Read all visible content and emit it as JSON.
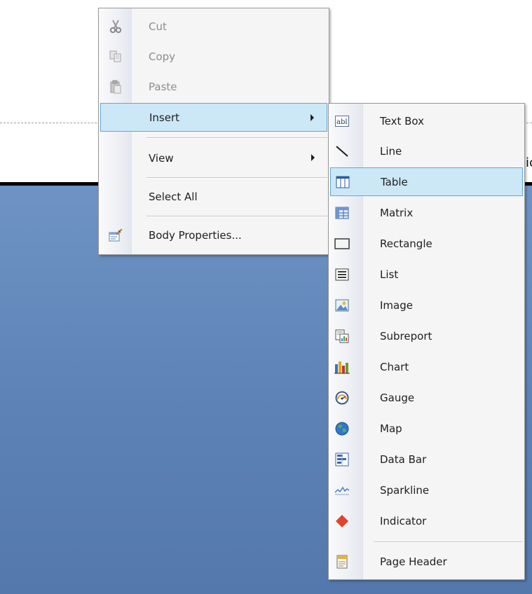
{
  "background": {
    "edge_text": "ic"
  },
  "context_menu": {
    "items": [
      {
        "label": "Cut",
        "icon": "scissors-icon",
        "enabled": false
      },
      {
        "label": "Copy",
        "icon": "copy-icon",
        "enabled": false
      },
      {
        "label": "Paste",
        "icon": "paste-icon",
        "enabled": false
      },
      {
        "label": "Insert",
        "submenu": true,
        "highlighted": true
      },
      {
        "label": "View",
        "submenu": true
      },
      {
        "label": "Select All"
      },
      {
        "label": "Body Properties...",
        "icon": "body-properties-icon"
      }
    ]
  },
  "insert_submenu": {
    "items": [
      {
        "label": "Text Box",
        "icon": "textbox-icon"
      },
      {
        "label": "Line",
        "icon": "line-icon"
      },
      {
        "label": "Table",
        "icon": "table-icon",
        "highlighted": true
      },
      {
        "label": "Matrix",
        "icon": "matrix-icon"
      },
      {
        "label": "Rectangle",
        "icon": "rectangle-icon"
      },
      {
        "label": "List",
        "icon": "list-icon"
      },
      {
        "label": "Image",
        "icon": "image-icon"
      },
      {
        "label": "Subreport",
        "icon": "subreport-icon"
      },
      {
        "label": "Chart",
        "icon": "chart-icon"
      },
      {
        "label": "Gauge",
        "icon": "gauge-icon"
      },
      {
        "label": "Map",
        "icon": "map-icon"
      },
      {
        "label": "Data Bar",
        "icon": "databar-icon"
      },
      {
        "label": "Sparkline",
        "icon": "sparkline-icon"
      },
      {
        "label": "Indicator",
        "icon": "indicator-icon"
      },
      {
        "label": "Page Header",
        "icon": "page-header-icon"
      }
    ]
  },
  "colors": {
    "highlight_bg": "#cce8f6",
    "highlight_border": "#63a5d8",
    "body_blue": "#6485b8",
    "disabled_text": "#8d8d8d"
  }
}
